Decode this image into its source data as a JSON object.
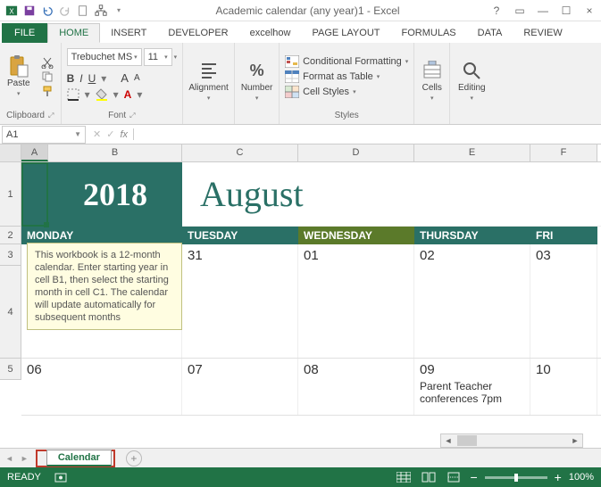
{
  "titlebar": {
    "title": "Academic calendar (any year)1 - Excel"
  },
  "ribbon": {
    "file": "FILE",
    "tabs": [
      "HOME",
      "INSERT",
      "DEVELOPER",
      "excelhow",
      "PAGE LAYOUT",
      "FORMULAS",
      "DATA",
      "REVIEW"
    ],
    "active_tab": "HOME",
    "clipboard": {
      "paste": "Paste",
      "label": "Clipboard"
    },
    "font": {
      "name": "Trebuchet MS",
      "size": "11",
      "bold": "B",
      "italic": "I",
      "underline": "U",
      "grow": "A",
      "shrink": "A",
      "label": "Font"
    },
    "alignment": {
      "btn": "Alignment"
    },
    "number": {
      "btn": "Number",
      "symbol": "%"
    },
    "styles": {
      "cond": "Conditional Formatting",
      "table": "Format as Table",
      "cell": "Cell Styles",
      "label": "Styles"
    },
    "cells": {
      "btn": "Cells"
    },
    "editing": {
      "btn": "Editing"
    }
  },
  "formula_bar": {
    "name_box": "A1",
    "fx": "fx",
    "formula": ""
  },
  "columns": [
    "A",
    "B",
    "C",
    "D",
    "E",
    "F"
  ],
  "rows": {
    "r1": "1",
    "r2": "2",
    "r3": "3",
    "r4": "4",
    "r5": "5"
  },
  "calendar": {
    "year": "2018",
    "month": "August",
    "days": {
      "mon": "MONDAY",
      "tue": "TUESDAY",
      "wed": "WEDNESDAY",
      "thu": "THURSDAY",
      "fri": "FRI"
    },
    "row3": {
      "mon": "",
      "tue": "31",
      "wed": "01",
      "thu": "02",
      "fri": "03"
    },
    "row5": {
      "mon": "06",
      "tue": "07",
      "wed": "08",
      "thu": "09",
      "fri": "10"
    },
    "event_thu": "Parent Teacher conferences 7pm"
  },
  "tooltip": "This workbook is a 12-month calendar. Enter starting year in cell B1, then select the starting month in cell C1. The calendar will update automatically for subsequent months",
  "sheet_tabs": {
    "tab1": "Calendar"
  },
  "status": {
    "ready": "READY",
    "zoom": "100%",
    "minus": "−",
    "plus": "+"
  }
}
